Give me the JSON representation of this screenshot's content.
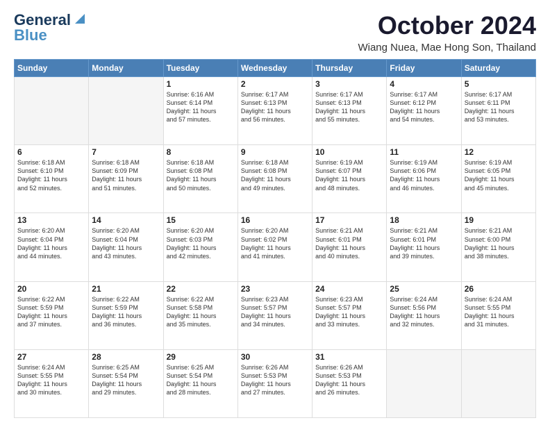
{
  "header": {
    "logo_line1": "General",
    "logo_line2": "Blue",
    "month": "October 2024",
    "location": "Wiang Nuea, Mae Hong Son, Thailand"
  },
  "weekdays": [
    "Sunday",
    "Monday",
    "Tuesday",
    "Wednesday",
    "Thursday",
    "Friday",
    "Saturday"
  ],
  "weeks": [
    [
      {
        "day": "",
        "info": ""
      },
      {
        "day": "",
        "info": ""
      },
      {
        "day": "1",
        "info": "Sunrise: 6:16 AM\nSunset: 6:14 PM\nDaylight: 11 hours\nand 57 minutes."
      },
      {
        "day": "2",
        "info": "Sunrise: 6:17 AM\nSunset: 6:13 PM\nDaylight: 11 hours\nand 56 minutes."
      },
      {
        "day": "3",
        "info": "Sunrise: 6:17 AM\nSunset: 6:13 PM\nDaylight: 11 hours\nand 55 minutes."
      },
      {
        "day": "4",
        "info": "Sunrise: 6:17 AM\nSunset: 6:12 PM\nDaylight: 11 hours\nand 54 minutes."
      },
      {
        "day": "5",
        "info": "Sunrise: 6:17 AM\nSunset: 6:11 PM\nDaylight: 11 hours\nand 53 minutes."
      }
    ],
    [
      {
        "day": "6",
        "info": "Sunrise: 6:18 AM\nSunset: 6:10 PM\nDaylight: 11 hours\nand 52 minutes."
      },
      {
        "day": "7",
        "info": "Sunrise: 6:18 AM\nSunset: 6:09 PM\nDaylight: 11 hours\nand 51 minutes."
      },
      {
        "day": "8",
        "info": "Sunrise: 6:18 AM\nSunset: 6:08 PM\nDaylight: 11 hours\nand 50 minutes."
      },
      {
        "day": "9",
        "info": "Sunrise: 6:18 AM\nSunset: 6:08 PM\nDaylight: 11 hours\nand 49 minutes."
      },
      {
        "day": "10",
        "info": "Sunrise: 6:19 AM\nSunset: 6:07 PM\nDaylight: 11 hours\nand 48 minutes."
      },
      {
        "day": "11",
        "info": "Sunrise: 6:19 AM\nSunset: 6:06 PM\nDaylight: 11 hours\nand 46 minutes."
      },
      {
        "day": "12",
        "info": "Sunrise: 6:19 AM\nSunset: 6:05 PM\nDaylight: 11 hours\nand 45 minutes."
      }
    ],
    [
      {
        "day": "13",
        "info": "Sunrise: 6:20 AM\nSunset: 6:04 PM\nDaylight: 11 hours\nand 44 minutes."
      },
      {
        "day": "14",
        "info": "Sunrise: 6:20 AM\nSunset: 6:04 PM\nDaylight: 11 hours\nand 43 minutes."
      },
      {
        "day": "15",
        "info": "Sunrise: 6:20 AM\nSunset: 6:03 PM\nDaylight: 11 hours\nand 42 minutes."
      },
      {
        "day": "16",
        "info": "Sunrise: 6:20 AM\nSunset: 6:02 PM\nDaylight: 11 hours\nand 41 minutes."
      },
      {
        "day": "17",
        "info": "Sunrise: 6:21 AM\nSunset: 6:01 PM\nDaylight: 11 hours\nand 40 minutes."
      },
      {
        "day": "18",
        "info": "Sunrise: 6:21 AM\nSunset: 6:01 PM\nDaylight: 11 hours\nand 39 minutes."
      },
      {
        "day": "19",
        "info": "Sunrise: 6:21 AM\nSunset: 6:00 PM\nDaylight: 11 hours\nand 38 minutes."
      }
    ],
    [
      {
        "day": "20",
        "info": "Sunrise: 6:22 AM\nSunset: 5:59 PM\nDaylight: 11 hours\nand 37 minutes."
      },
      {
        "day": "21",
        "info": "Sunrise: 6:22 AM\nSunset: 5:59 PM\nDaylight: 11 hours\nand 36 minutes."
      },
      {
        "day": "22",
        "info": "Sunrise: 6:22 AM\nSunset: 5:58 PM\nDaylight: 11 hours\nand 35 minutes."
      },
      {
        "day": "23",
        "info": "Sunrise: 6:23 AM\nSunset: 5:57 PM\nDaylight: 11 hours\nand 34 minutes."
      },
      {
        "day": "24",
        "info": "Sunrise: 6:23 AM\nSunset: 5:57 PM\nDaylight: 11 hours\nand 33 minutes."
      },
      {
        "day": "25",
        "info": "Sunrise: 6:24 AM\nSunset: 5:56 PM\nDaylight: 11 hours\nand 32 minutes."
      },
      {
        "day": "26",
        "info": "Sunrise: 6:24 AM\nSunset: 5:55 PM\nDaylight: 11 hours\nand 31 minutes."
      }
    ],
    [
      {
        "day": "27",
        "info": "Sunrise: 6:24 AM\nSunset: 5:55 PM\nDaylight: 11 hours\nand 30 minutes."
      },
      {
        "day": "28",
        "info": "Sunrise: 6:25 AM\nSunset: 5:54 PM\nDaylight: 11 hours\nand 29 minutes."
      },
      {
        "day": "29",
        "info": "Sunrise: 6:25 AM\nSunset: 5:54 PM\nDaylight: 11 hours\nand 28 minutes."
      },
      {
        "day": "30",
        "info": "Sunrise: 6:26 AM\nSunset: 5:53 PM\nDaylight: 11 hours\nand 27 minutes."
      },
      {
        "day": "31",
        "info": "Sunrise: 6:26 AM\nSunset: 5:53 PM\nDaylight: 11 hours\nand 26 minutes."
      },
      {
        "day": "",
        "info": ""
      },
      {
        "day": "",
        "info": ""
      }
    ]
  ]
}
